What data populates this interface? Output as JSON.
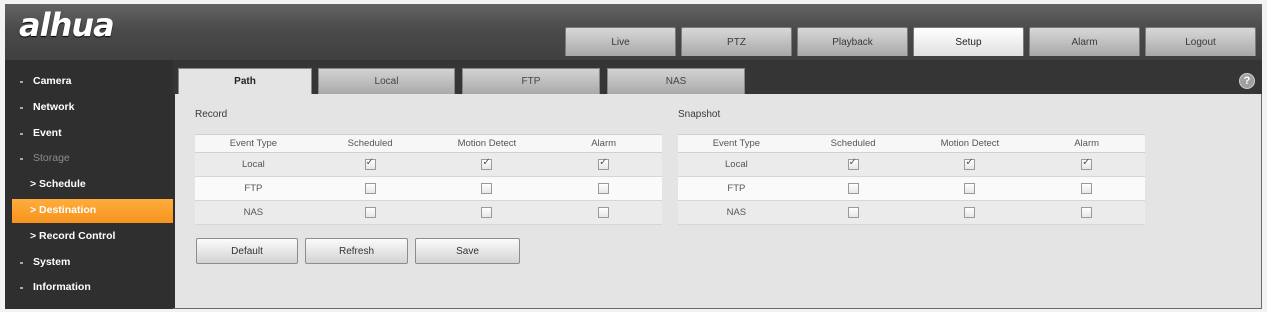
{
  "header": {
    "logo_text": "alhua",
    "logo_icon": "dahua-logo"
  },
  "nav": {
    "tabs": [
      {
        "label": "Live",
        "active": false
      },
      {
        "label": "PTZ",
        "active": false
      },
      {
        "label": "Playback",
        "active": false
      },
      {
        "label": "Setup",
        "active": true
      },
      {
        "label": "Alarm",
        "active": false
      },
      {
        "label": "Logout",
        "active": false
      }
    ]
  },
  "sidebar": {
    "items": [
      {
        "label": "Camera",
        "active": false,
        "expanded": false
      },
      {
        "label": "Network",
        "active": false,
        "expanded": false
      },
      {
        "label": "Event",
        "active": false,
        "expanded": false
      },
      {
        "label": "Storage",
        "active": false,
        "expanded": true
      },
      {
        "label": "> Schedule",
        "active": false,
        "expanded": false
      },
      {
        "label": "> Destination",
        "active": true,
        "expanded": false
      },
      {
        "label": "> Record Control",
        "active": false,
        "expanded": false
      },
      {
        "label": "System",
        "active": false,
        "expanded": false
      },
      {
        "label": "Information",
        "active": false,
        "expanded": false
      }
    ]
  },
  "subtabs": [
    {
      "label": "Path",
      "active": true
    },
    {
      "label": "Local",
      "active": false
    },
    {
      "label": "FTP",
      "active": false
    },
    {
      "label": "NAS",
      "active": false
    }
  ],
  "help": {
    "label": "?",
    "icon": "help-icon"
  },
  "record": {
    "title": "Record",
    "columns": [
      "Event Type",
      "Scheduled",
      "Motion Detect",
      "Alarm"
    ],
    "rows": [
      {
        "event": "Local",
        "scheduled": true,
        "motion_detect": true,
        "alarm": true
      },
      {
        "event": "FTP",
        "scheduled": false,
        "motion_detect": false,
        "alarm": false
      },
      {
        "event": "NAS",
        "scheduled": false,
        "motion_detect": false,
        "alarm": false
      }
    ]
  },
  "snapshot": {
    "title": "Snapshot",
    "columns": [
      "Event Type",
      "Scheduled",
      "Motion Detect",
      "Alarm"
    ],
    "rows": [
      {
        "event": "Local",
        "scheduled": true,
        "motion_detect": true,
        "alarm": true
      },
      {
        "event": "FTP",
        "scheduled": false,
        "motion_detect": false,
        "alarm": false
      },
      {
        "event": "NAS",
        "scheduled": false,
        "motion_detect": false,
        "alarm": false
      }
    ]
  },
  "buttons": {
    "default": "Default",
    "refresh": "Refresh",
    "save": "Save"
  },
  "colors": {
    "accent": "#f7931e",
    "header": "#404040",
    "sidebar": "#2f2f2f",
    "panel": "#e4e4e4"
  }
}
